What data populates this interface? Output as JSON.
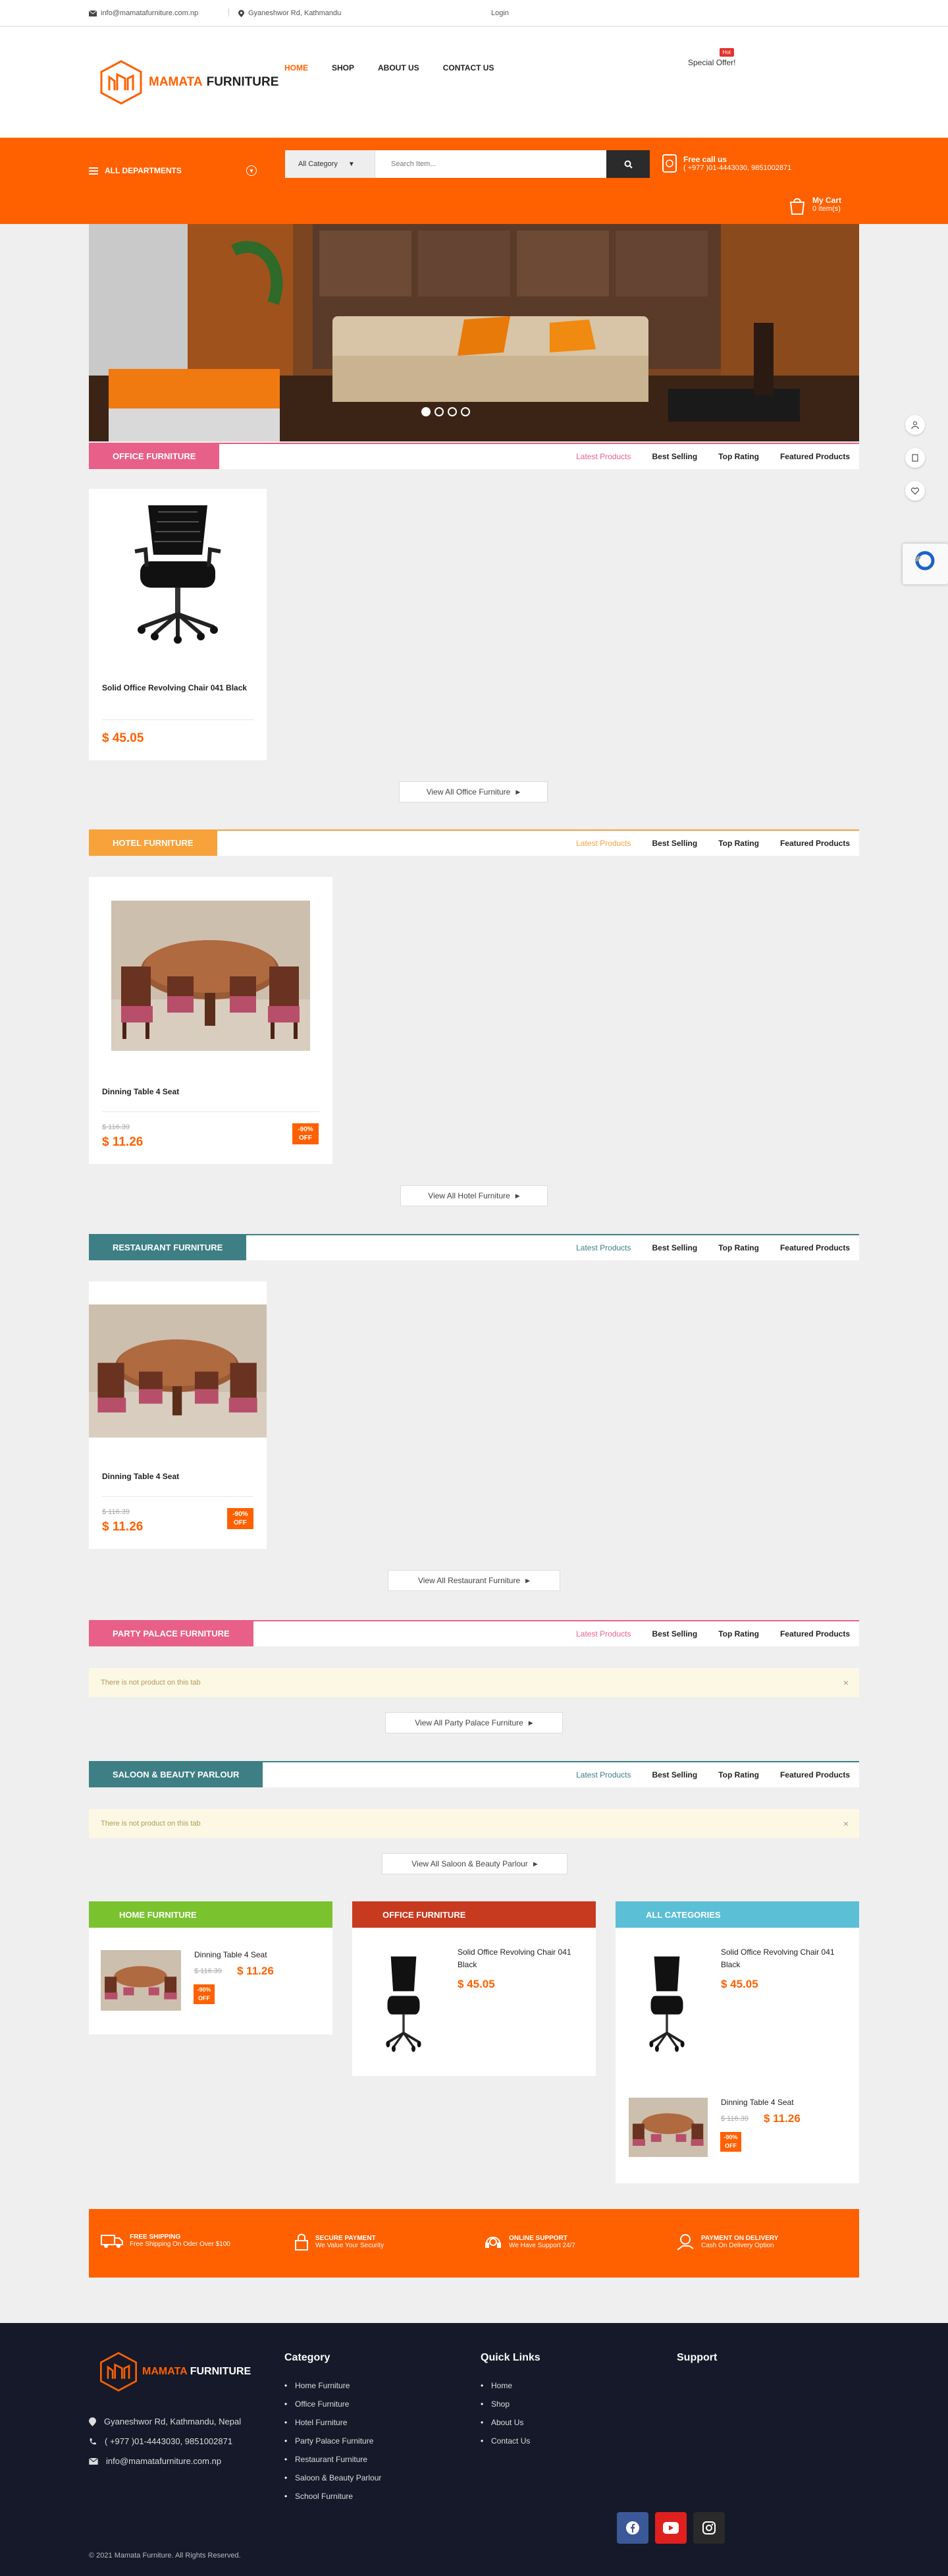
{
  "topbar": {
    "email": "info@mamatafurniture.com.np",
    "address": "Gyaneshwor Rd, Kathmandu",
    "login": "Login"
  },
  "logo": {
    "brand": "MAMATA",
    "suffix": "FURNITURE"
  },
  "nav": {
    "items": [
      "HOME",
      "SHOP",
      "ABOUT US",
      "CONTACT US"
    ],
    "active": "HOME"
  },
  "offer": {
    "badge": "Hot",
    "label": "Special Offer!"
  },
  "orange_nav": {
    "departments": "ALL DEPARTMENTS",
    "category": "All Category",
    "search_placeholder": "Search Item...",
    "call_title": "Free call us",
    "call_numbers": "( +977 )01-4443030, 9851002871",
    "cart_title": "My Cart",
    "cart_count": "0 item(s)"
  },
  "hero": {
    "slides": 4,
    "active_slide": 1
  },
  "tabs": [
    "Latest Products",
    "Best Selling",
    "Top Rating",
    "Featured Products"
  ],
  "sections": [
    {
      "title": "OFFICE FURNITURE",
      "color": "#e8608a",
      "products": [
        {
          "name": "Solid Office Revolving Chair 041 Black",
          "price": "$ 45.05"
        }
      ],
      "view_all": "View All Office Furniture"
    },
    {
      "title": "HOTEL FURNITURE",
      "color": "#f7a23b",
      "products": [
        {
          "name": "Dinning Table 4 Seat",
          "old_price": "$ 116.39",
          "price": "$ 11.26",
          "badge_pct": "-90%",
          "badge_off": "OFF"
        }
      ],
      "view_all": "View All Hotel Furniture"
    },
    {
      "title": "RESTAURANT FURNITURE",
      "color": "#3d7f85",
      "products": [
        {
          "name": "Dinning Table 4 Seat",
          "old_price": "$ 116.39",
          "price": "$ 11.26",
          "badge_pct": "-90%",
          "badge_off": "OFF"
        }
      ],
      "view_all": "View All Restaurant Furniture"
    },
    {
      "title": "PARTY PALACE FURNITURE",
      "color": "#e8608a",
      "notice": "There is not product on this tab",
      "view_all": "View All Party Palace Furniture"
    },
    {
      "title": "SALOON & BEAUTY PARLOUR",
      "color": "#3d7f85",
      "notice": "There is not product on this tab",
      "view_all": "View All Saloon & Beauty Parlour"
    }
  ],
  "blocks": [
    {
      "title": "HOME FURNITURE",
      "color": "#7ac22e",
      "items": [
        {
          "name": "Dinning Table 4 Seat",
          "old_price": "$ 116.39",
          "price": "$ 11.26",
          "badge_pct": "-90%",
          "badge_off": "OFF"
        }
      ]
    },
    {
      "title": "OFFICE FURNITURE",
      "color": "#c83a1f",
      "items": [
        {
          "name": "Solid Office Revolving Chair 041 Black",
          "price": "$ 45.05"
        }
      ]
    },
    {
      "title": "ALL CATEGORIES",
      "color": "#5bbfd6",
      "items": [
        {
          "name": "Solid Office Revolving Chair 041 Black",
          "price": "$ 45.05"
        },
        {
          "name": "Dinning Table 4 Seat",
          "old_price": "$ 116.39",
          "price": "$ 11.26",
          "badge_pct": "-90%",
          "badge_off": "OFF"
        }
      ]
    }
  ],
  "features": [
    {
      "title": "FREE SHIPPING",
      "sub": "Free Shipping On Oder Over $100",
      "icon": "truck-icon"
    },
    {
      "title": "SECURE PAYMENT",
      "sub": "We Value Your Security",
      "icon": "lock-icon"
    },
    {
      "title": "ONLINE SUPPORT",
      "sub": "We Have Support 24/7",
      "icon": "headset-icon"
    },
    {
      "title": "PAYMENT ON DELIVERY",
      "sub": "Cash On Delivery Option",
      "icon": "cash-icon"
    }
  ],
  "footer": {
    "address": "Gyaneshwor Rd, Kathmandu, Nepal",
    "phone": "( +977 )01-4443030, 9851002871",
    "email": "info@mamatafurniture.com.np",
    "category_title": "Category",
    "categories": [
      "Home Furniture",
      "Office Furniture",
      "Hotel Furniture",
      "Party Palace Furniture",
      "Restaurant Furniture",
      "Saloon & Beauty Parlour",
      "School Furniture"
    ],
    "links_title": "Quick Links",
    "links": [
      "Home",
      "Shop",
      "About Us",
      "Contact Us"
    ],
    "support_title": "Support",
    "copyright": "© 2021 Mamata Furniture. All Rights Reserved."
  }
}
